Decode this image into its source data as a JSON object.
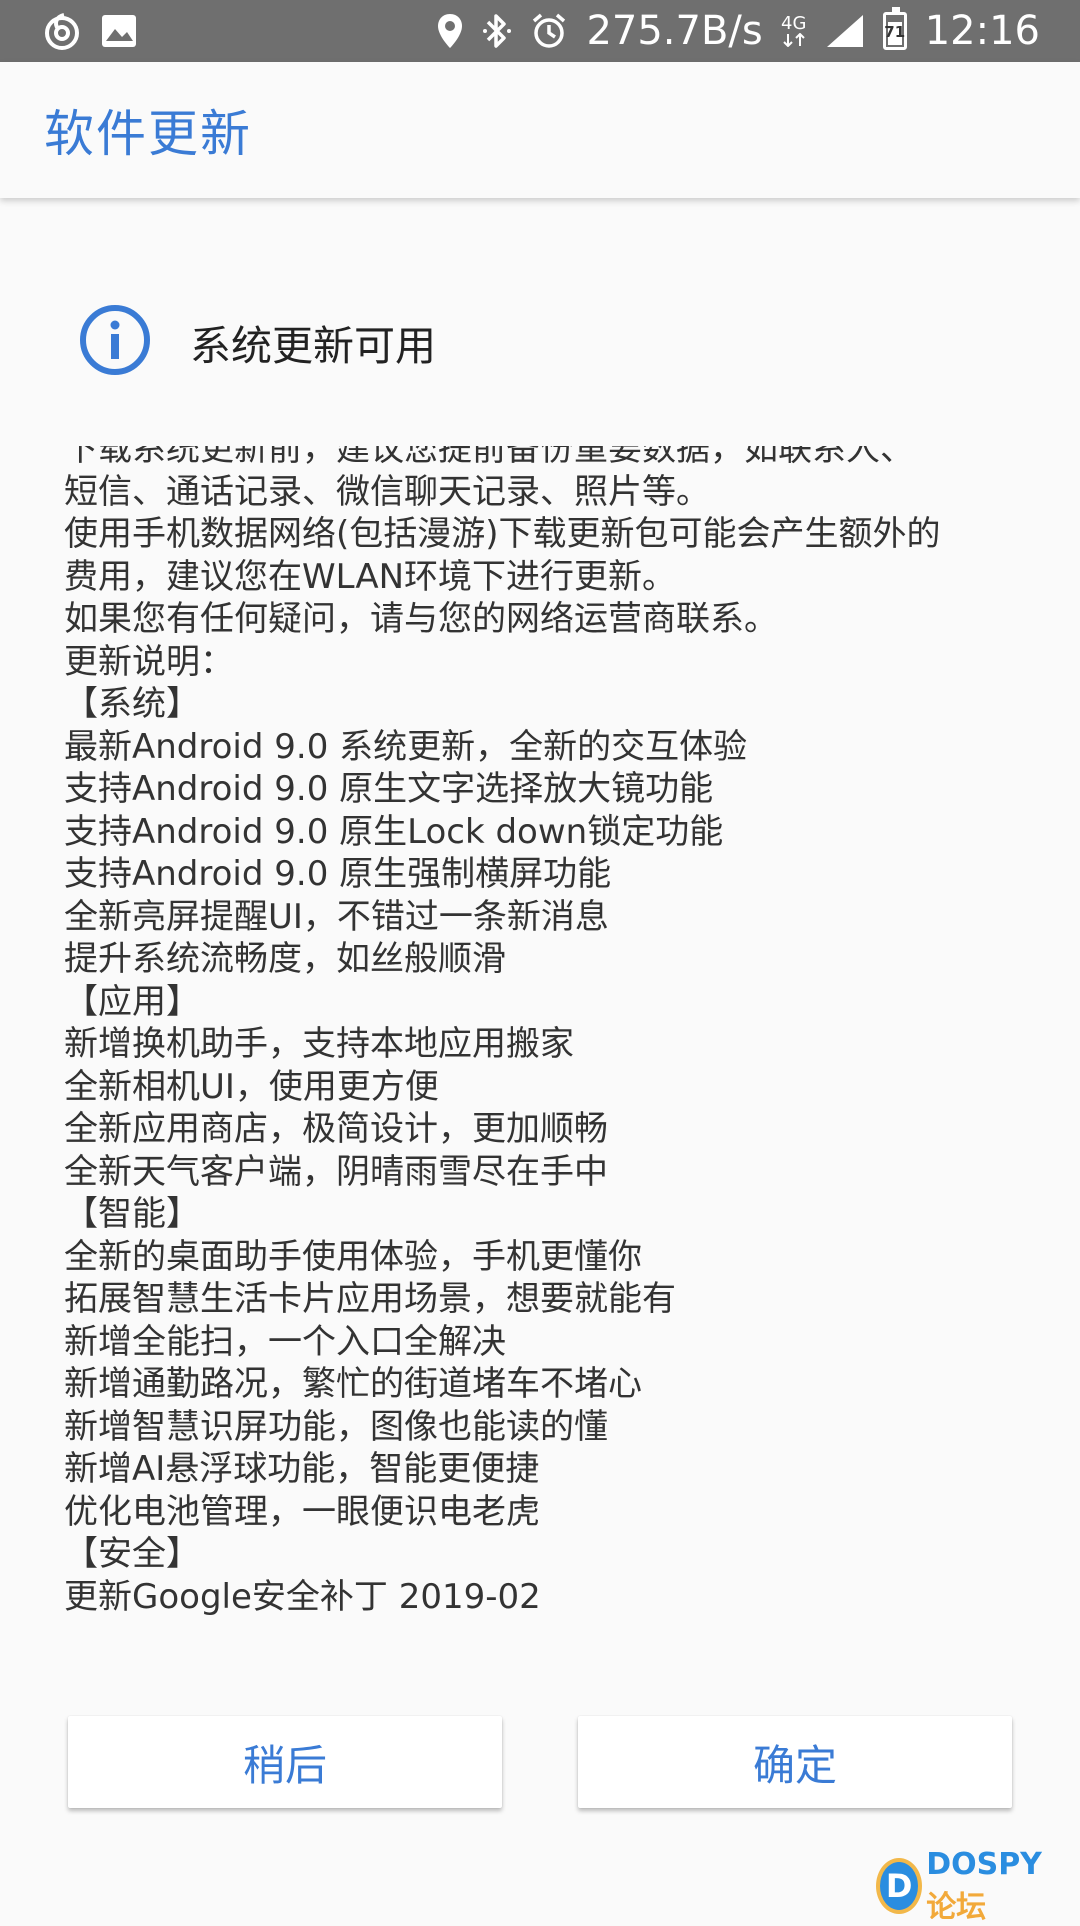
{
  "status_bar": {
    "left_icons": [
      "netease-music-icon",
      "gallery-icon"
    ],
    "right_icons": [
      "location-icon",
      "bluetooth-icon",
      "alarm-icon"
    ],
    "speed": "275.7B/s",
    "network": "4G",
    "battery_level": "71",
    "time": "12:16"
  },
  "toolbar": {
    "title": "软件更新"
  },
  "header": {
    "icon": "info-icon",
    "title": "系统更新可用"
  },
  "content": {
    "lines": [
      "下载系统更新前，建议您提前备份重要数据，如联系人、",
      "短信、通话记录、微信聊天记录、照片等。",
      "使用手机数据网络(包括漫游)下载更新包可能会产生额外的",
      "费用，建议您在WLAN环境下进行更新。",
      "如果您有任何疑问，请与您的网络运营商联系。",
      "更新说明：",
      "【系统】",
      "最新Android 9.0 系统更新，全新的交互体验",
      "支持Android 9.0 原生文字选择放大镜功能",
      "支持Android 9.0 原生Lock down锁定功能",
      "支持Android 9.0 原生强制横屏功能",
      "全新亮屏提醒UI，不错过一条新消息",
      "提升系统流畅度，如丝般顺滑",
      "【应用】",
      "新增换机助手，支持本地应用搬家",
      "全新相机UI，使用更方便",
      "全新应用商店，极简设计，更加顺畅",
      "全新天气客户端，阴晴雨雪尽在手中",
      "【智能】",
      "全新的桌面助手使用体验，手机更懂你",
      "拓展智慧生活卡片应用场景，想要就能有",
      "新增全能扫，一个入口全解决",
      "新增通勤路况，繁忙的街道堵车不堵心",
      "新增智慧识屏功能，图像也能读的懂",
      "新增AI悬浮球功能，智能更便捷",
      "优化电池管理，一眼便识电老虎",
      "【安全】",
      "更新Google安全补丁 2019-02"
    ]
  },
  "buttons": {
    "later_label": "稍后",
    "confirm_label": "确定"
  },
  "watermark": {
    "logo_letter": "D",
    "brand": "DOSPY",
    "brand_cn": "论坛"
  },
  "colors": {
    "accent": "#3a7bd5",
    "status_bar": "#6f6f6f",
    "background": "#fafafa"
  }
}
